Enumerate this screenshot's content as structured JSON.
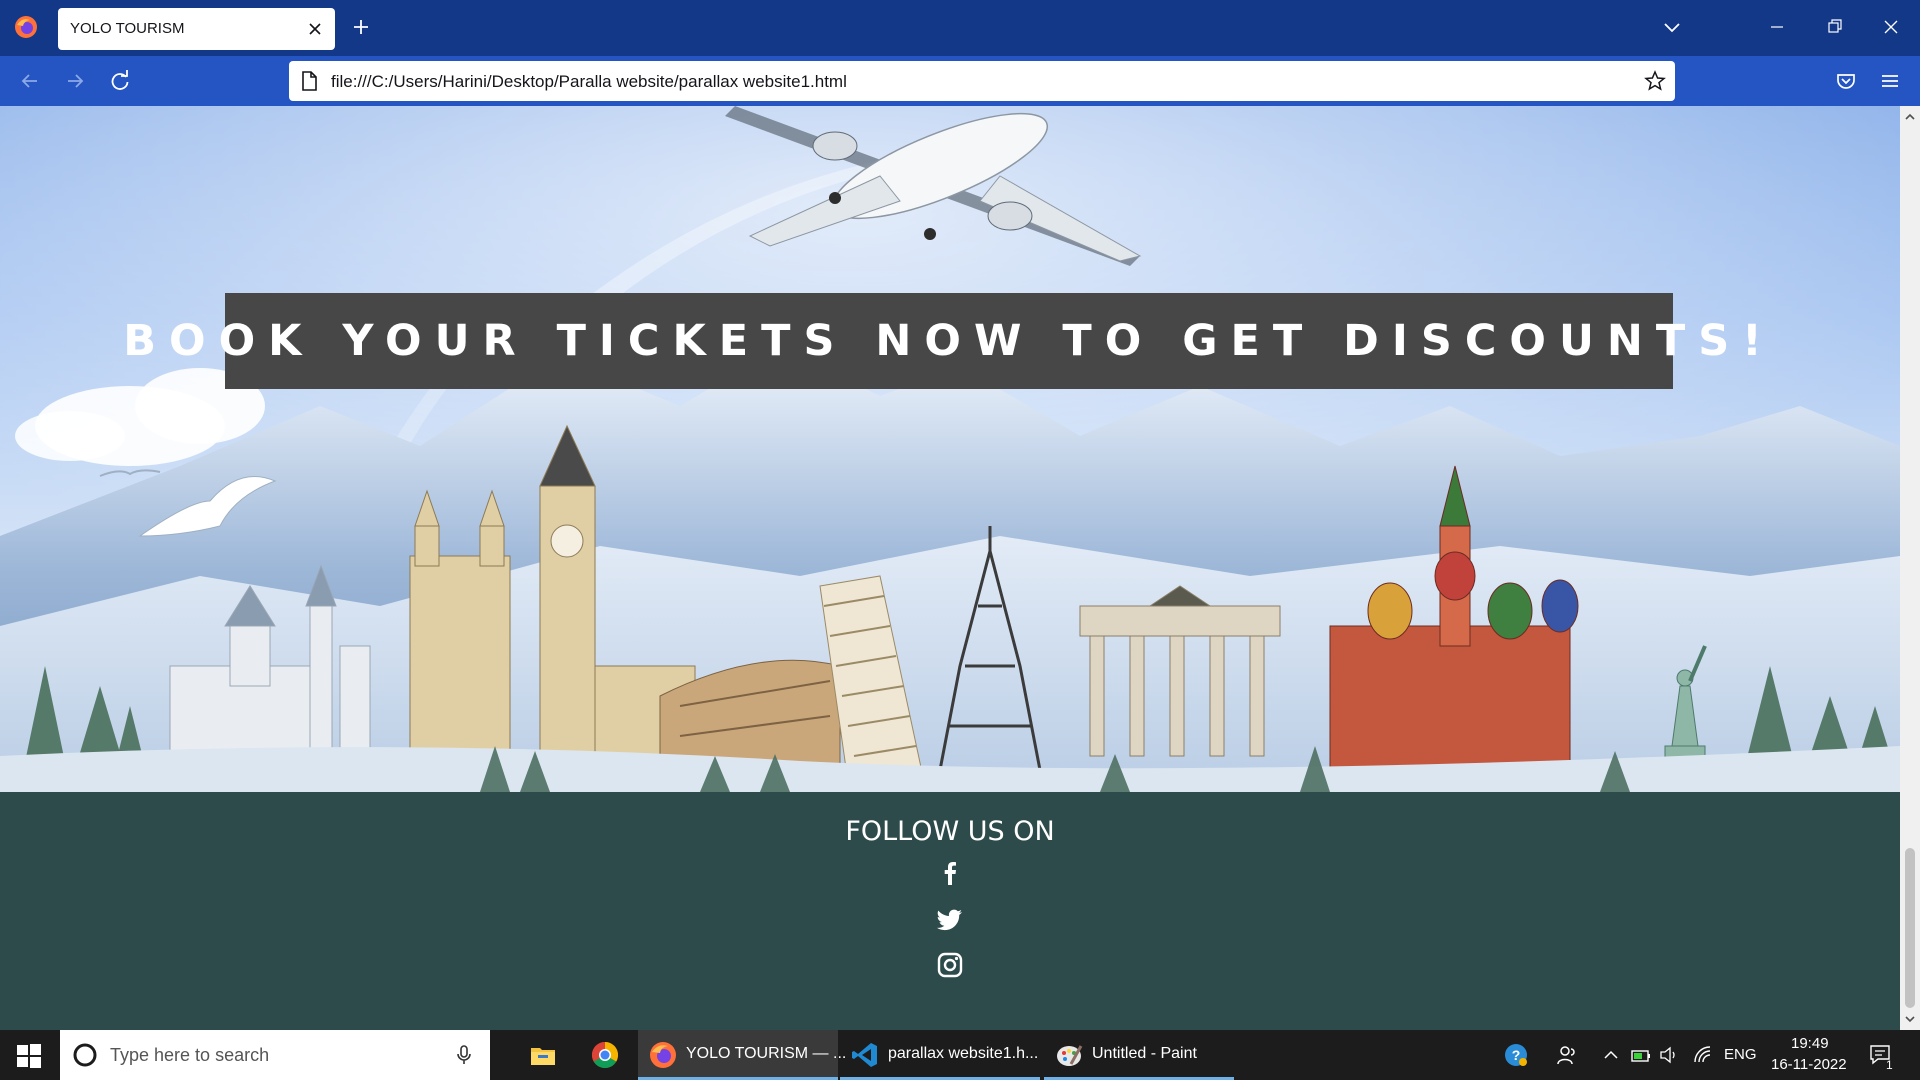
{
  "browser": {
    "tab_title": "YOLO TOURISM",
    "url": "file:///C:/Users/Harini/Desktop/Paralla website/parallax website1.html"
  },
  "page": {
    "banner": "BOOK YOUR TICKETS NOW TO GET DISCOUNTS!",
    "follow_heading": "FOLLOW US ON",
    "social": [
      "facebook-icon",
      "twitter-icon",
      "instagram-icon"
    ]
  },
  "taskbar": {
    "search_placeholder": "Type here to search",
    "apps": [
      {
        "label": "YOLO TOURISM — ...",
        "icon": "firefox-icon"
      },
      {
        "label": "parallax website1.h...",
        "icon": "vscode-icon"
      },
      {
        "label": "Untitled - Paint",
        "icon": "paint-icon"
      }
    ],
    "language": "ENG",
    "time": "19:49",
    "date": "16-11-2022",
    "notification_count": "1"
  }
}
